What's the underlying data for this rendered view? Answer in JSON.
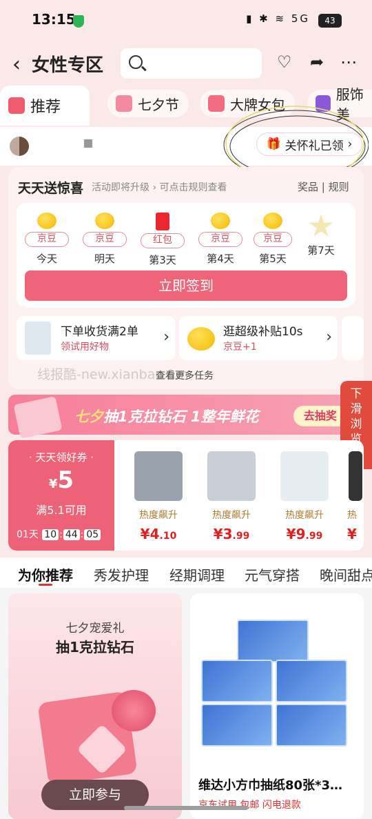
{
  "status": {
    "time": "13:15",
    "right_icons": "▮ ✱ ≋ 5G",
    "battery": "43"
  },
  "header": {
    "title": "女性专区",
    "search_placeholder": ""
  },
  "category_tabs": [
    {
      "label": "推荐",
      "color": "#f15a6e"
    },
    {
      "label": "七夕节",
      "color": "#f48aa0"
    },
    {
      "label": "大牌女包",
      "color": "#f26d7f"
    },
    {
      "label": "服饰美",
      "color": "#8a5ad8"
    }
  ],
  "gift_pill": {
    "label": "关怀礼已领",
    "arrow": "›"
  },
  "sign_in": {
    "title": "天天送惊喜",
    "subtitle": "活动即将升级 › 可点击规则查看",
    "links": "奖品 | 规则",
    "days": [
      {
        "reward": "京豆",
        "label": "今天"
      },
      {
        "reward": "京豆",
        "label": "明天"
      },
      {
        "reward": "红包",
        "label": "第3天"
      },
      {
        "reward": "京豆",
        "label": "第4天"
      },
      {
        "reward": "京豆",
        "label": "第5天"
      }
    ],
    "day7_label": "第7天",
    "button": "立即签到",
    "tasks": [
      {
        "title": "下单收货满2单",
        "sub": "领试用好物"
      },
      {
        "title": "逛超级补贴10s",
        "sub": "京豆+1"
      }
    ],
    "more": "查看更多任务",
    "watermark": "线报酷-new.xianbao.fun"
  },
  "side_float": {
    "label": "下滑浏览",
    "arrow": "︾"
  },
  "banner": {
    "text_hl": "七夕",
    "text": "抽1克拉钻石 1整年鲜花",
    "button": "去抽奖 ›"
  },
  "coupon": {
    "title": "· 天天领好券 ·",
    "currency": "¥",
    "amount": "5",
    "condition": "满5.1可用",
    "timer_days": "01天",
    "timer_h": "10",
    "timer_m": "44",
    "timer_s": "05"
  },
  "products": [
    {
      "tag": "热度飙升",
      "int": "¥4",
      "dec": ".10",
      "color": "#9aa3ad"
    },
    {
      "tag": "热度飙升",
      "int": "¥3",
      "dec": ".99",
      "color": "#c9cfd6"
    },
    {
      "tag": "热度飙升",
      "int": "¥9",
      "dec": ".99",
      "color": "#e6eef2"
    },
    {
      "tag": "热",
      "int": "¥",
      "dec": "",
      "color": "#333333"
    }
  ],
  "feed_tabs": [
    "为你推荐",
    "秀发护理",
    "经期调理",
    "元气穿搭",
    "晚间甜点"
  ],
  "cards": {
    "card1": {
      "line1": "七夕宠爱礼",
      "line2": "抽1克拉钻石",
      "button": "立即参与"
    },
    "card2": {
      "name": "维达小方巾抽纸80张*3…",
      "tags": "京东试用  包邮  闪电退款"
    }
  }
}
